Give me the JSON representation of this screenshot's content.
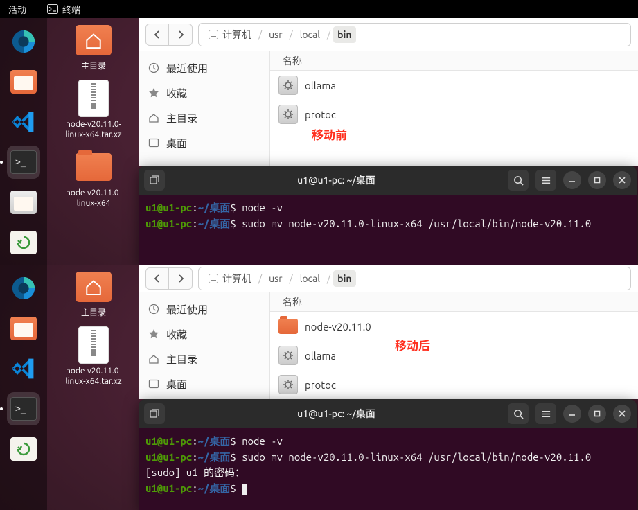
{
  "topbar": {
    "activities": "活动",
    "terminal": "终端"
  },
  "desktop": {
    "home_label": "主目录",
    "archive_label": "node-v20.11.0-linux-x64.tar.xz",
    "folder_label": "node-v20.11.0-linux-x64"
  },
  "fm": {
    "path": {
      "computer": "计算机",
      "usr": "usr",
      "local": "local",
      "bin": "bin"
    },
    "sidebar": {
      "recent": "最近使用",
      "starred": "收藏",
      "home": "主目录",
      "desktop": "桌面"
    },
    "col_name": "名称",
    "files_before": [
      {
        "name": "ollama",
        "type": "exe"
      },
      {
        "name": "protoc",
        "type": "exe"
      }
    ],
    "files_after": [
      {
        "name": "node-v20.11.0",
        "type": "folder"
      },
      {
        "name": "ollama",
        "type": "exe"
      },
      {
        "name": "protoc",
        "type": "exe"
      }
    ],
    "label_before": "移动前",
    "label_after": "移动后"
  },
  "term": {
    "title": "u1@u1-pc: ~/桌面",
    "prompt_user": "u1@u1-pc",
    "prompt_colon": ":",
    "prompt_path": "~/桌面",
    "prompt_dollar": "$ ",
    "lines_top": [
      {
        "cmd": "node -v"
      },
      {
        "cmd": "sudo mv node-v20.11.0-linux-x64 /usr/local/bin/node-v20.11.0"
      }
    ],
    "lines_bottom": [
      {
        "cmd": "node -v"
      },
      {
        "cmd": "sudo mv node-v20.11.0-linux-x64 /usr/local/bin/node-v20.11.0"
      },
      {
        "raw": "[sudo] u1 的密码："
      },
      {
        "cmd": ""
      }
    ]
  }
}
